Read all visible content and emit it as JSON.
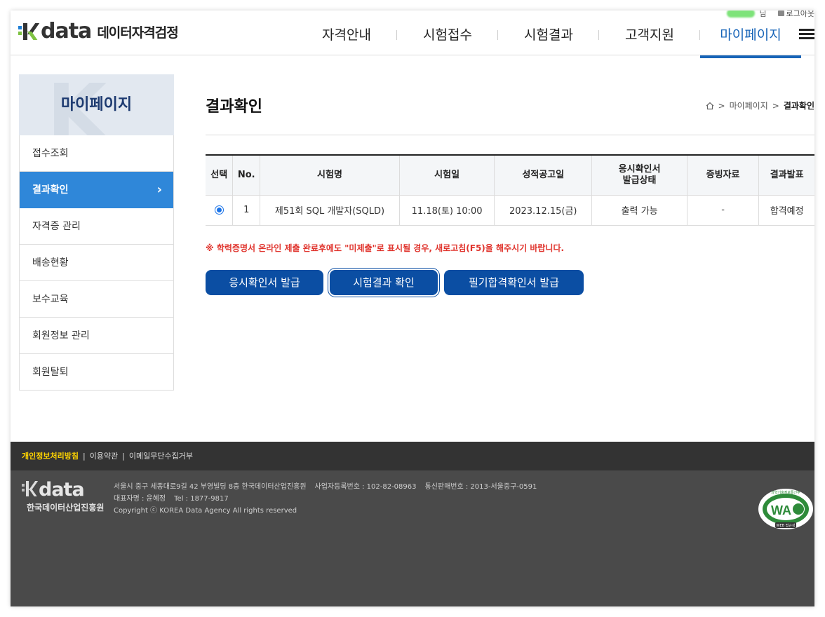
{
  "header": {
    "logo_text": "data",
    "logo_sub": "데이터자격검정",
    "user_suffix": "님",
    "logout": "로그아웃",
    "nav": [
      {
        "label": "자격안내"
      },
      {
        "label": "시험접수"
      },
      {
        "label": "시험결과"
      },
      {
        "label": "고객지원"
      },
      {
        "label": "마이페이지"
      }
    ]
  },
  "sidebar": {
    "title": "마이페이지",
    "items": [
      {
        "label": "접수조회"
      },
      {
        "label": "결과확인"
      },
      {
        "label": "자격증 관리"
      },
      {
        "label": "배송현황"
      },
      {
        "label": "보수교육"
      },
      {
        "label": "회원정보 관리"
      },
      {
        "label": "회원탈퇴"
      }
    ]
  },
  "main": {
    "title": "결과확인",
    "breadcrumb": {
      "mid": "마이페이지",
      "current": "결과확인"
    },
    "table": {
      "headers": [
        "선택",
        "No.",
        "시험명",
        "시험일",
        "성적공고일",
        "응시확인서\n발급상태",
        "증빙자료",
        "결과발표"
      ],
      "rows": [
        {
          "no": "1",
          "name": "제51회 SQL 개발자(SQLD)",
          "date": "11.18(토) 10:00",
          "announce": "2023.12.15(금)",
          "status": "출력 가능",
          "evidence": "-",
          "result": "합격예정"
        }
      ]
    },
    "notice": "※ 학력증명서 온라인 제출 완료후에도 \"미제출\"로 표시될 경우, 새로고침(F5)을 해주시기 바랍니다.",
    "buttons": {
      "issue_cert": "응시확인서 발급",
      "check_result": "시험결과 확인",
      "written_pass": "필기합격확인서 발급"
    }
  },
  "footer": {
    "links": {
      "privacy": "개인정보처리방침",
      "terms": "이용약관",
      "email": "이메일무단수집거부"
    },
    "logo_text": "data",
    "logo_sub": "한국데이터산업진흥원",
    "address": "서울시 중구 세종대로9길 42 부영빌딩 8층 한국데이터산업진흥원",
    "biz_no": "사업자등록번호 : 102-82-08963",
    "mail_order": "통신판매번호 : 2013-서울중구-0591",
    "ceo": "대표자명 : 윤혜정",
    "tel": "Tel : 1877-9817",
    "copyright": "Copyright ⓒ KOREA Data Agency All rights reserved",
    "badge": {
      "top": "과학기술정보통신부",
      "mark": "WA",
      "bottom": "WEB 접근성"
    }
  },
  "colors": {
    "accent": "#1764b8",
    "button": "#0b4ea3",
    "sidebar_active": "#2f87d9",
    "notice": "#e0342d",
    "footer": "#4a4a4a"
  }
}
